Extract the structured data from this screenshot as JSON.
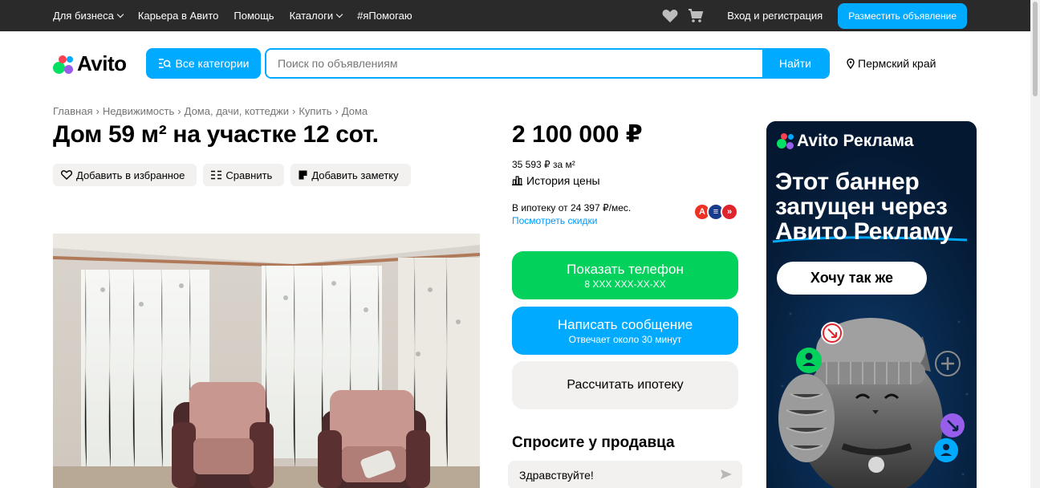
{
  "topbar": {
    "nav": [
      "Для бизнеса",
      "Карьера в Авито",
      "Помощь",
      "Каталоги",
      "#яПомогаю"
    ],
    "login": "Вход и регистрация",
    "post_ad": "Разместить объявление"
  },
  "header": {
    "logo": "Avito",
    "categories": "Все категории",
    "search_placeholder": "Поиск по объявлениям",
    "search_button": "Найти",
    "region": "Пермский край"
  },
  "breadcrumb": [
    "Главная",
    "Недвижимость",
    "Дома, дачи, коттеджи",
    "Купить",
    "Дома"
  ],
  "listing": {
    "title": "Дом 59 м² на участке 12 сот.",
    "actions": {
      "favorite": "Добавить в избранное",
      "compare": "Сравнить",
      "note": "Добавить заметку"
    }
  },
  "price": {
    "value": "2 100 000 ₽",
    "per_m": "35 593 ₽ за м²",
    "history": "История цены",
    "mortgage": "В ипотеку от 24 397 ₽/мес.",
    "discounts": "Посмотреть скидки"
  },
  "contact": {
    "phone_label": "Показать телефон",
    "phone_mask": "8 XXX XXX-XX-XX",
    "message_label": "Написать сообщение",
    "message_sub": "Отвечает около 30 минут",
    "calc_label": "Рассчитать ипотеку"
  },
  "ask": {
    "title": "Спросите у продавца",
    "message": "Здравствуйте!"
  },
  "banner": {
    "brand": "Avito Реклама",
    "line1": "Этот баннер",
    "line2": "запущен через",
    "line3": "Авито Рекламу",
    "button": "Хочу так же"
  },
  "colors": {
    "accent": "#00aaff",
    "green": "#02d15c",
    "topbar": "#2a2a2a",
    "banner_bg": "#062040"
  }
}
